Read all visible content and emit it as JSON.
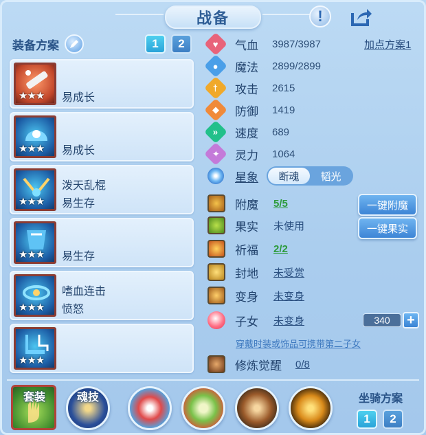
{
  "header": {
    "title": "战备",
    "alert_icon": "alert-icon",
    "share_icon": "share-icon"
  },
  "left": {
    "heading": "装备方案",
    "scheme_buttons": [
      "1",
      "2"
    ],
    "equipment": [
      {
        "line1": "",
        "line2": "易成长",
        "stars": "★★★",
        "color": "#e8452c"
      },
      {
        "line1": "",
        "line2": "易成长",
        "stars": "★★★",
        "color": "#2b8fe0"
      },
      {
        "line1": "泼天乱棍",
        "line2": "易生存",
        "stars": "★★★",
        "color": "#2b8fe0"
      },
      {
        "line1": "",
        "line2": "易生存",
        "stars": "★★★",
        "color": "#2b8fe0"
      },
      {
        "line1": "嗜血连击",
        "line2": "愤怒",
        "stars": "★★★",
        "color": "#2b8fe0"
      },
      {
        "line1": "",
        "line2": "",
        "stars": "★★★",
        "color": "#2b8fe0"
      }
    ]
  },
  "stats": {
    "add_point_plan": "加点方案1",
    "rows": [
      {
        "label": "气血",
        "value": "3987/3987",
        "color": "#e8637a",
        "glyph": "♥"
      },
      {
        "label": "魔法",
        "value": "2899/2899",
        "color": "#4a9fe8",
        "glyph": "●"
      },
      {
        "label": "攻击",
        "value": "2615",
        "color": "#f0a92a",
        "glyph": "†"
      },
      {
        "label": "防御",
        "value": "1419",
        "color": "#f08a3a",
        "glyph": "◆"
      },
      {
        "label": "速度",
        "value": "689",
        "color": "#22c08a",
        "glyph": "»"
      },
      {
        "label": "灵力",
        "value": "1064",
        "color": "#c47ad9",
        "glyph": "✦"
      }
    ],
    "star_label": "星象",
    "star_options": [
      "断魂",
      "韬光"
    ]
  },
  "enhance": {
    "rows": [
      {
        "label": "附魔",
        "value": "5/5",
        "style": "green"
      },
      {
        "label": "果实",
        "value": "未使用",
        "style": "dark"
      },
      {
        "label": "祈福",
        "value": "2/2",
        "style": "green"
      },
      {
        "label": "封地",
        "value": "未受赏",
        "style": "dark-ul"
      },
      {
        "label": "变身",
        "value": "未变身",
        "style": "dark-ul"
      },
      {
        "label": "子女",
        "value": "未变身",
        "style": "dark-ul"
      }
    ],
    "btn_enchant": "一键附魔",
    "btn_fruit": "一键果实",
    "child_value": "340",
    "child_plus": "+",
    "hint": "穿戴时装或饰品可携带第二子女",
    "cultivate_label": "修炼觉醒",
    "cultivate_value": "0/8"
  },
  "bottom": {
    "set_tag": "套装",
    "soul_tag": "魂技",
    "mount_label": "坐骑方案",
    "mount_buttons": [
      "1",
      "2"
    ]
  }
}
